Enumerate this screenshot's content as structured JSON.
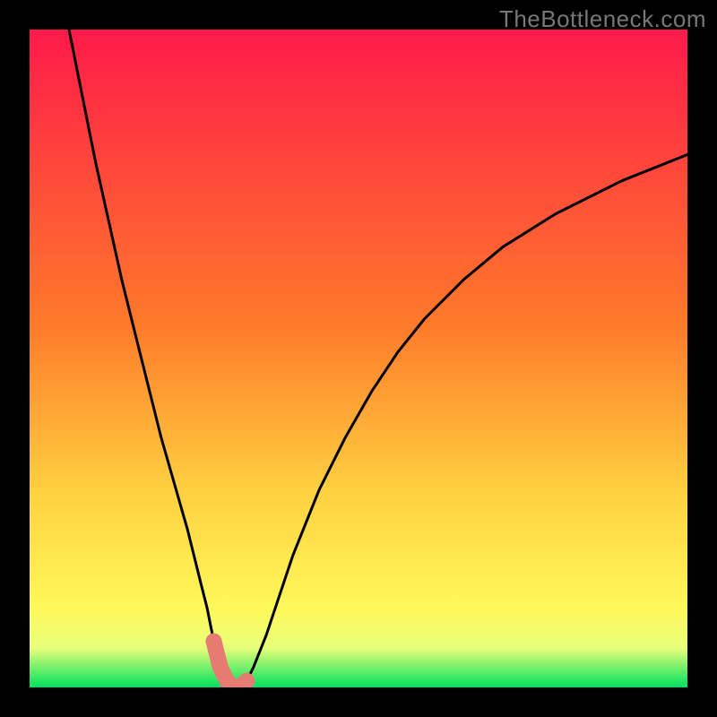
{
  "watermark": "TheBottleneck.com",
  "colors": {
    "background": "#000000",
    "gradient_top": "#ff1a4a",
    "gradient_mid1": "#ff7a2a",
    "gradient_mid2": "#ffd040",
    "gradient_mid3": "#fff85a",
    "gradient_mid4": "#e8ff7a",
    "gradient_bottom": "#00e060",
    "curve": "#000000",
    "highlight": "#e57b73"
  },
  "chart_data": {
    "type": "line",
    "title": "",
    "xlabel": "",
    "ylabel": "",
    "xlim": [
      0,
      100
    ],
    "ylim": [
      0,
      100
    ],
    "grid": false,
    "legend": false,
    "series": [
      {
        "name": "bottleneck-curve",
        "x": [
          6,
          8,
          10,
          12,
          14,
          16,
          18,
          20,
          22,
          24,
          26,
          27,
          28,
          29,
          30,
          31,
          32,
          33,
          34,
          36,
          38,
          40,
          44,
          48,
          52,
          56,
          60,
          66,
          72,
          80,
          90,
          100
        ],
        "values": [
          100,
          90,
          80,
          71,
          62,
          54,
          46,
          38,
          31,
          24,
          16,
          12,
          7,
          3,
          1,
          0,
          0,
          1,
          3,
          8,
          14,
          20,
          30,
          38,
          45,
          51,
          56,
          62,
          67,
          72,
          77,
          81
        ]
      }
    ],
    "highlights": [
      {
        "name": "low-bottleneck-region",
        "x_range": [
          27.5,
          33.5
        ],
        "y_max": 9
      }
    ],
    "y_color_scale": {
      "0": "#00e060",
      "5": "#a0ff70",
      "10": "#f8ff60",
      "30": "#ffd040",
      "55": "#ff7a2a",
      "100": "#ff1a4a"
    }
  }
}
